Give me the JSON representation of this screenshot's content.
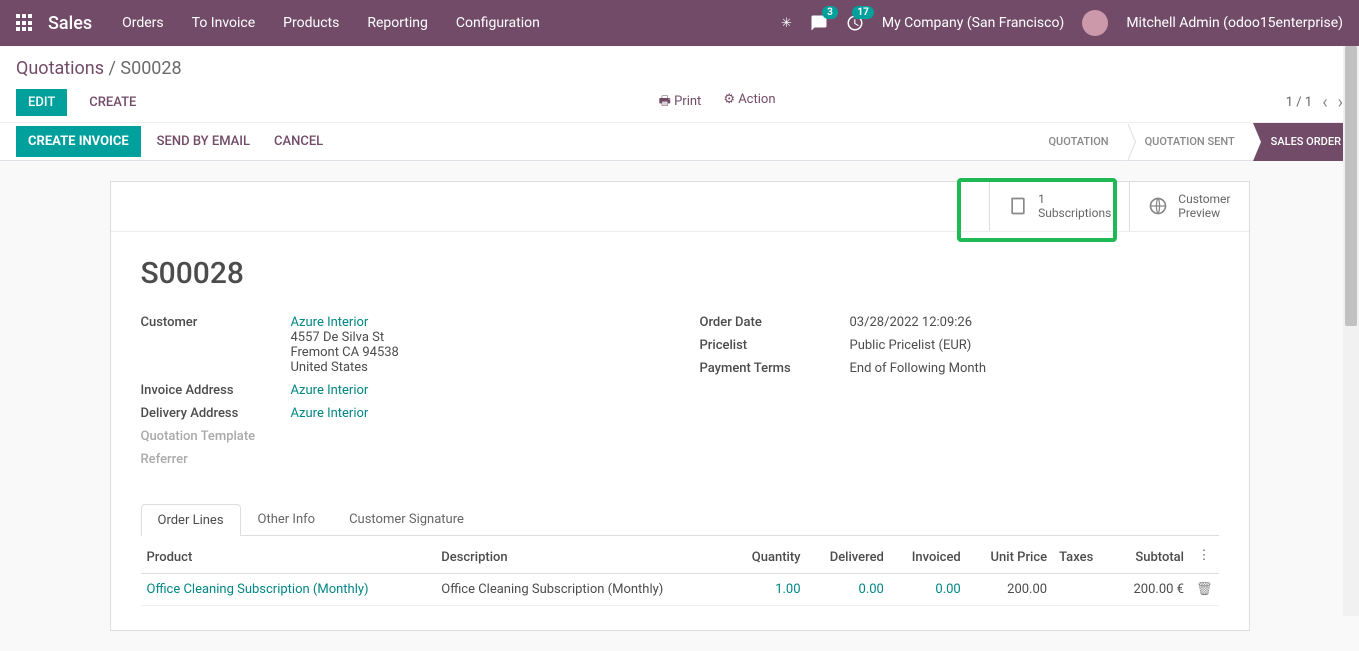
{
  "topnav": {
    "brand": "Sales",
    "menu": [
      "Orders",
      "To Invoice",
      "Products",
      "Reporting",
      "Configuration"
    ],
    "chat_badge": "3",
    "activity_badge": "17",
    "company": "My Company (San Francisco)",
    "user": "Mitchell Admin (odoo15enterprise)"
  },
  "breadcrumb": {
    "root": "Quotations",
    "current": "S00028"
  },
  "controls": {
    "edit": "EDIT",
    "create": "CREATE",
    "print": "Print",
    "action": "Action",
    "pager": "1 / 1"
  },
  "statusbar": {
    "create_invoice": "CREATE INVOICE",
    "send_email": "SEND BY EMAIL",
    "cancel": "CANCEL",
    "stages": [
      "QUOTATION",
      "QUOTATION SENT",
      "SALES ORDER"
    ],
    "active_stage": 2
  },
  "statbuttons": {
    "subs_count": "1",
    "subs_label": "Subscriptions",
    "preview_l1": "Customer",
    "preview_l2": "Preview"
  },
  "record": {
    "name": "S00028",
    "customer_label": "Customer",
    "customer_name": "Azure Interior",
    "customer_addr1": "4557 De Silva St",
    "customer_addr2": "Fremont CA 94538",
    "customer_addr3": "United States",
    "invoice_addr_label": "Invoice Address",
    "invoice_addr": "Azure Interior",
    "delivery_addr_label": "Delivery Address",
    "delivery_addr": "Azure Interior",
    "quote_tpl_label": "Quotation Template",
    "referrer_label": "Referrer",
    "order_date_label": "Order Date",
    "order_date": "03/28/2022 12:09:26",
    "pricelist_label": "Pricelist",
    "pricelist": "Public Pricelist (EUR)",
    "payterms_label": "Payment Terms",
    "payterms": "End of Following Month"
  },
  "tabs": [
    "Order Lines",
    "Other Info",
    "Customer Signature"
  ],
  "table": {
    "headers": {
      "product": "Product",
      "desc": "Description",
      "qty": "Quantity",
      "deliv": "Delivered",
      "inv": "Invoiced",
      "uprice": "Unit Price",
      "tax": "Taxes",
      "sub": "Subtotal"
    },
    "rows": [
      {
        "product": "Office Cleaning Subscription (Monthly)",
        "desc": "Office Cleaning Subscription (Monthly)",
        "qty": "1.00",
        "deliv": "0.00",
        "inv": "0.00",
        "uprice": "200.00",
        "tax": "",
        "sub": "200.00 €"
      }
    ]
  }
}
